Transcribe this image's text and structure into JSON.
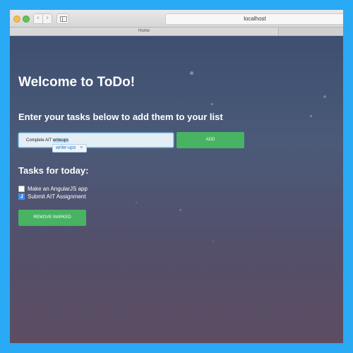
{
  "browser": {
    "address": "localhost",
    "tab_title": "Home",
    "back_glyph": "‹",
    "forward_glyph": "›"
  },
  "page": {
    "title": "Welcome to ToDo!",
    "subtitle": "Enter your tasks below to add them to your list",
    "input_value_prefix": "Complete AIT ",
    "input_value_highlight": "writeups",
    "suggestion": "write-ups",
    "suggestion_close": "×",
    "add_label": "ADD",
    "tasks_heading": "Tasks for today:",
    "tasks": [
      {
        "label": "Make an AngularJS app",
        "checked": false
      },
      {
        "label": "Submit AIT Assignment",
        "checked": true
      }
    ],
    "remove_label": "REMOVE MARKED"
  },
  "colors": {
    "frame": "#2aa9f4",
    "button_green": "#48b363",
    "checkbox_blue": "#3f8ef0"
  }
}
